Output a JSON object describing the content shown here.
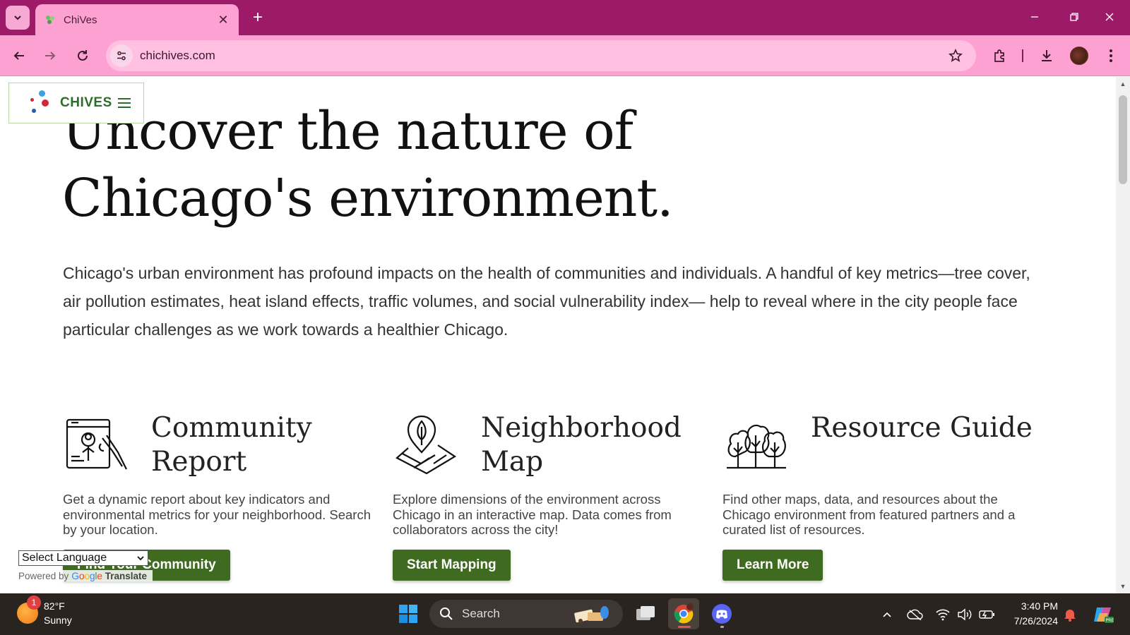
{
  "browser": {
    "tab_title": "ChiVes",
    "url": "chichives.com",
    "tabstrip_color": "#9c1a68",
    "toolbar_color": "#fda1d3"
  },
  "site": {
    "logo_text": "CHIVES",
    "hero_title": "Uncover the nature of Chicago's environment.",
    "hero_body": "Chicago's urban environment has profound impacts on the health of communities and individuals. A handful of key metrics—tree cover, air pollution estimates, heat island effects, traffic volumes, and social vulnerability index— help to reveal where in the city people face particular challenges as we work towards a healthier Chicago.",
    "button_color": "#3e6b1f",
    "cards": [
      {
        "icon": "community-report-icon",
        "title": "Community Report",
        "description": "Get a dynamic report about key indicators and environmental metrics for your neighborhood. Search by your location.",
        "button": "Find Your Community"
      },
      {
        "icon": "map-pin-icon",
        "title": "Neighborhood Map",
        "description": "Explore dimensions of the environment across Chicago in an interactive map. Data comes from collaborators across the city!",
        "button": "Start Mapping"
      },
      {
        "icon": "trees-icon",
        "title": "Resource Guide",
        "description": "Find other maps, data, and resources about the Chicago environment from featured partners and a curated list of resources.",
        "button": "Learn More"
      }
    ],
    "translate": {
      "select_label": "Select Language",
      "powered_by": "Powered by",
      "google": "Google",
      "translate": "Translate"
    }
  },
  "taskbar": {
    "weather_badge": "1",
    "temperature": "82°F",
    "condition": "Sunny",
    "search_label": "Search",
    "time": "3:40 PM",
    "date": "7/26/2024"
  }
}
